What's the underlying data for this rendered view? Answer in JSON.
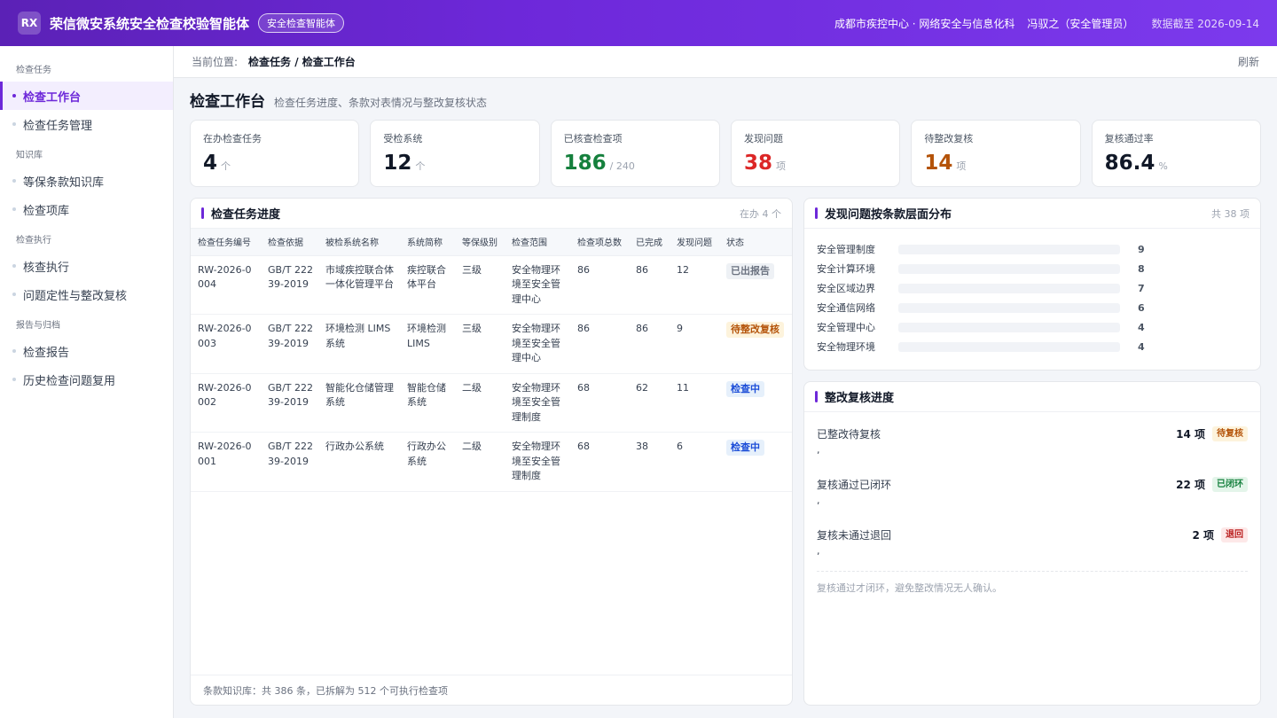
{
  "header": {
    "logo": "RX",
    "title": "荣信微安系统安全检查校验智能体",
    "badge": "安全检查智能体",
    "org": "成都市疾控中心 · 网络安全与信息化科",
    "user": "冯驭之（安全管理员）",
    "as_of": "数据截至 2026-09-14"
  },
  "sidebar": {
    "groups": [
      {
        "label": "检查任务",
        "items": [
          {
            "label": "检查工作台",
            "active": true
          },
          {
            "label": "检查任务管理"
          }
        ]
      },
      {
        "label": "知识库",
        "items": [
          {
            "label": "等保条款知识库"
          },
          {
            "label": "检查项库"
          }
        ]
      },
      {
        "label": "检查执行",
        "items": [
          {
            "label": "核查执行"
          },
          {
            "label": "问题定性与整改复核"
          }
        ]
      },
      {
        "label": "报告与归档",
        "items": [
          {
            "label": "检查报告"
          },
          {
            "label": "历史检查问题复用"
          }
        ]
      }
    ]
  },
  "breadcrumb": {
    "prefix": "当前位置:",
    "path": "检查任务 / 检查工作台",
    "refresh": "刷新"
  },
  "page": {
    "title": "检查工作台",
    "subtitle": "检查任务进度、条款对表情况与整改复核状态"
  },
  "stats": [
    {
      "label": "在办检查任务",
      "value": "4",
      "unit": "个",
      "color": "#111827"
    },
    {
      "label": "受检系统",
      "value": "12",
      "unit": "个",
      "color": "#111827"
    },
    {
      "label": "已核查检查项",
      "value": "186",
      "unit": "/ 240",
      "color": "#15803d"
    },
    {
      "label": "发现问题",
      "value": "38",
      "unit": "项",
      "color": "#dc2626"
    },
    {
      "label": "待整改复核",
      "value": "14",
      "unit": "项",
      "color": "#b45309"
    },
    {
      "label": "复核通过率",
      "value": "86.4",
      "unit": "%",
      "color": "#111827"
    }
  ],
  "tasks": {
    "title": "检查任务进度",
    "meta": "在办 4 个",
    "columns": [
      "检查任务编号",
      "检查依据",
      "被检系统名称",
      "系统简称",
      "等保级别",
      "检查范围",
      "检查项总数",
      "已完成",
      "发现问题",
      "状态"
    ],
    "rows": [
      {
        "id": "RW-2026-0004",
        "basis": "GB/T 22239-2019",
        "system": "市域疾控联合体一体化管理平台",
        "short": "疾控联合体平台",
        "level": "三级",
        "scope": "安全物理环境至安全管理中心",
        "total": "86",
        "done": "86",
        "issues": "12",
        "status": "已出报告",
        "status_style": "grey"
      },
      {
        "id": "RW-2026-0003",
        "basis": "GB/T 22239-2019",
        "system": "环境检测 LIMS 系统",
        "short": "环境检测 LIMS",
        "level": "三级",
        "scope": "安全物理环境至安全管理中心",
        "total": "86",
        "done": "86",
        "issues": "9",
        "status": "待整改复核",
        "status_style": "yellow"
      },
      {
        "id": "RW-2026-0002",
        "basis": "GB/T 22239-2019",
        "system": "智能化仓储管理系统",
        "short": "智能仓储系统",
        "level": "二级",
        "scope": "安全物理环境至安全管理制度",
        "total": "68",
        "done": "62",
        "issues": "11",
        "status": "检查中",
        "status_style": "blue"
      },
      {
        "id": "RW-2026-0001",
        "basis": "GB/T 22239-2019",
        "system": "行政办公系统",
        "short": "行政办公系统",
        "level": "二级",
        "scope": "安全物理环境至安全管理制度",
        "total": "68",
        "done": "38",
        "issues": "6",
        "status": "检查中",
        "status_style": "blue"
      }
    ],
    "footer": "条款知识库：共 386 条，已拆解为 512 个可执行检查项"
  },
  "distribution": {
    "title": "发现问题按条款层面分布",
    "meta": "共 38 项",
    "max": 9,
    "items": [
      {
        "label": "安全管理制度",
        "value": 9,
        "color": "#6d28d9"
      },
      {
        "label": "安全计算环境",
        "value": 8,
        "color": "#7c3aed"
      },
      {
        "label": "安全区域边界",
        "value": 7,
        "color": "#8b5cf6"
      },
      {
        "label": "安全通信网络",
        "value": 6,
        "color": "#a78bfa"
      },
      {
        "label": "安全管理中心",
        "value": 4,
        "color": "#c4b5fd"
      },
      {
        "label": "安全物理环境",
        "value": 4,
        "color": "#0e8fa8"
      }
    ]
  },
  "rectification": {
    "title": "整改复核进度",
    "items": [
      {
        "label": "已整改待复核",
        "count": "14 项",
        "tag": "待复核",
        "tag_style": "yellow",
        "tick": ","
      },
      {
        "label": "复核通过已闭环",
        "count": "22 项",
        "tag": "已闭环",
        "tag_style": "green",
        "tick": ","
      },
      {
        "label": "复核未通过退回",
        "count": "2 项",
        "tag": "退回",
        "tag_style": "red",
        "tick": ","
      }
    ],
    "note": "复核通过才闭环，避免整改情况无人确认。"
  }
}
